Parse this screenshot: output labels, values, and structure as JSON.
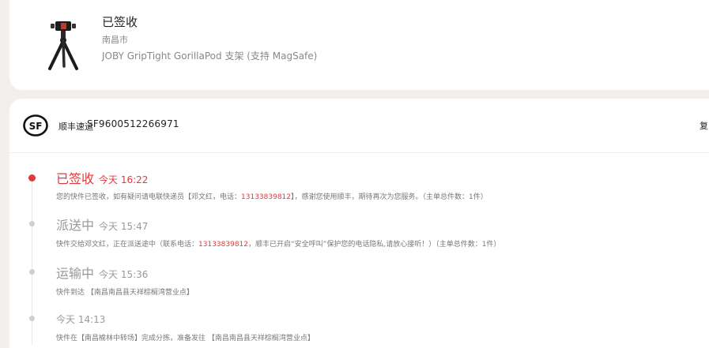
{
  "product": {
    "status": "已签收",
    "city": "南昌市",
    "name": "JOBY GripTight GorillaPod 支架 (支持 MagSafe)",
    "thumbnail_icon": "tripod-phone-holder-image"
  },
  "carrier": {
    "name": "顺丰速运",
    "tracking_number": "SF9600512266971",
    "copy_label": "复",
    "logo_icon": "sf-express-logo"
  },
  "timeline": [
    {
      "status": "已签收",
      "time": "今天 16:22",
      "desc_before": "您的快件已签收，如有疑问请电联快递员【邓文红，电话：",
      "phone": "13133839812",
      "desc_after": "】，感谢您使用顺丰，期待再次为您服务。（主单总件数：1件）"
    },
    {
      "status": "派送中",
      "time": "今天 15:47",
      "desc_before": "快件交给邓文红，正在派送途中（联系电话：",
      "phone": "13133839812",
      "desc_after": "，顺丰已开启“安全呼叫”保护您的电话隐私,请放心接听！）（主单总件数：1件）"
    },
    {
      "status": "运输中",
      "time": "今天 15:36",
      "desc": "快件到达 【南昌南昌县天祥棕榈湾营业点】"
    },
    {
      "time": "今天 14:13",
      "desc": "快件在【南昌榆林中转场】完成分拣，准备发往 【南昌南昌县天祥棕榈湾营业点】"
    }
  ],
  "colors": {
    "accent": "#e4393c",
    "muted": "#999999",
    "background": "#f2efec"
  }
}
